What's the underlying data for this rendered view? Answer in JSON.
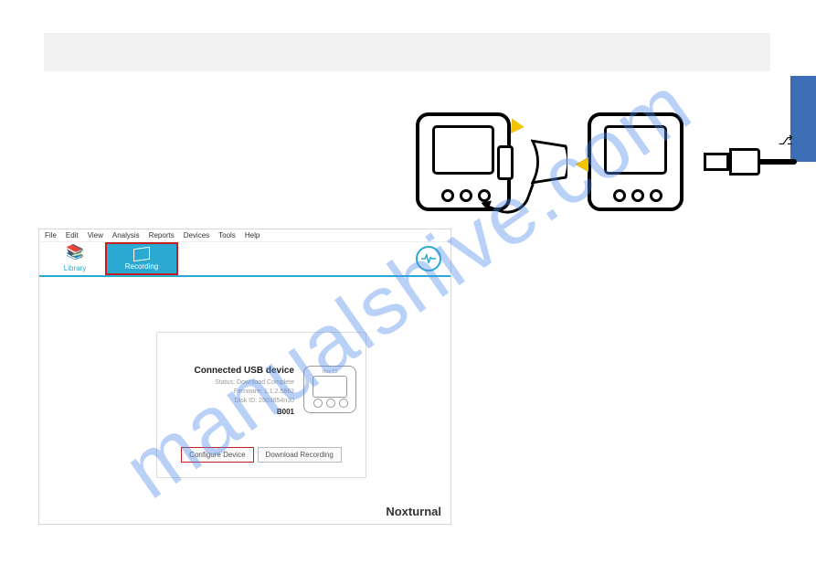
{
  "watermark": "manualshive.com",
  "app": {
    "menu": [
      "File",
      "Edit",
      "View",
      "Analysis",
      "Reports",
      "Devices",
      "Tools",
      "Help"
    ],
    "tabs": {
      "library": "Library",
      "recording": "Recording"
    },
    "card": {
      "title": "Connected USB device",
      "line1": "Status: Download Complete",
      "line2": "Firmware: 1.1.2.5862",
      "line3": "Disk ID: 2803854n30",
      "line4": "B001",
      "device_label": "Nox T3"
    },
    "buttons": {
      "configure": "Configure Device",
      "download": "Download Recording"
    },
    "brand": "Noxturnal"
  }
}
